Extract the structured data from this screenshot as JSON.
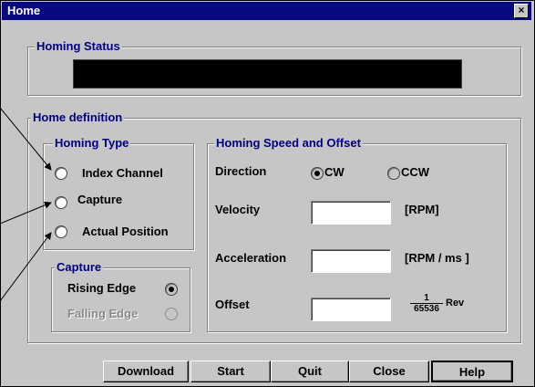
{
  "window": {
    "title": "Home",
    "close_glyph": "×"
  },
  "homing_status": {
    "title": "Homing Status"
  },
  "home_definition": {
    "title": "Home definition"
  },
  "homing_type": {
    "title": "Homing Type",
    "options": [
      "Index Channel",
      "Capture",
      "Actual Position"
    ],
    "selected": null
  },
  "capture": {
    "title": "Capture",
    "rising_edge": "Rising Edge",
    "falling_edge": "Falling Edge",
    "selected": "Rising Edge"
  },
  "speed_offset": {
    "title": "Homing Speed and Offset",
    "direction_label": "Direction",
    "cw": "CW",
    "ccw": "CCW",
    "selected_direction": "CW",
    "velocity_label": "Velocity",
    "velocity_value": "",
    "velocity_unit": "[RPM]",
    "acceleration_label": "Acceleration",
    "acceleration_value": "",
    "acceleration_unit": "[RPM / ms ]",
    "offset_label": "Offset",
    "offset_value": "",
    "offset_unit_numerator": "1",
    "offset_unit_denominator": "65536",
    "offset_unit_suffix": "Rev"
  },
  "buttons": {
    "download": "Download",
    "start": "Start",
    "quit": "Quit",
    "close": "Close",
    "help": "Help"
  }
}
